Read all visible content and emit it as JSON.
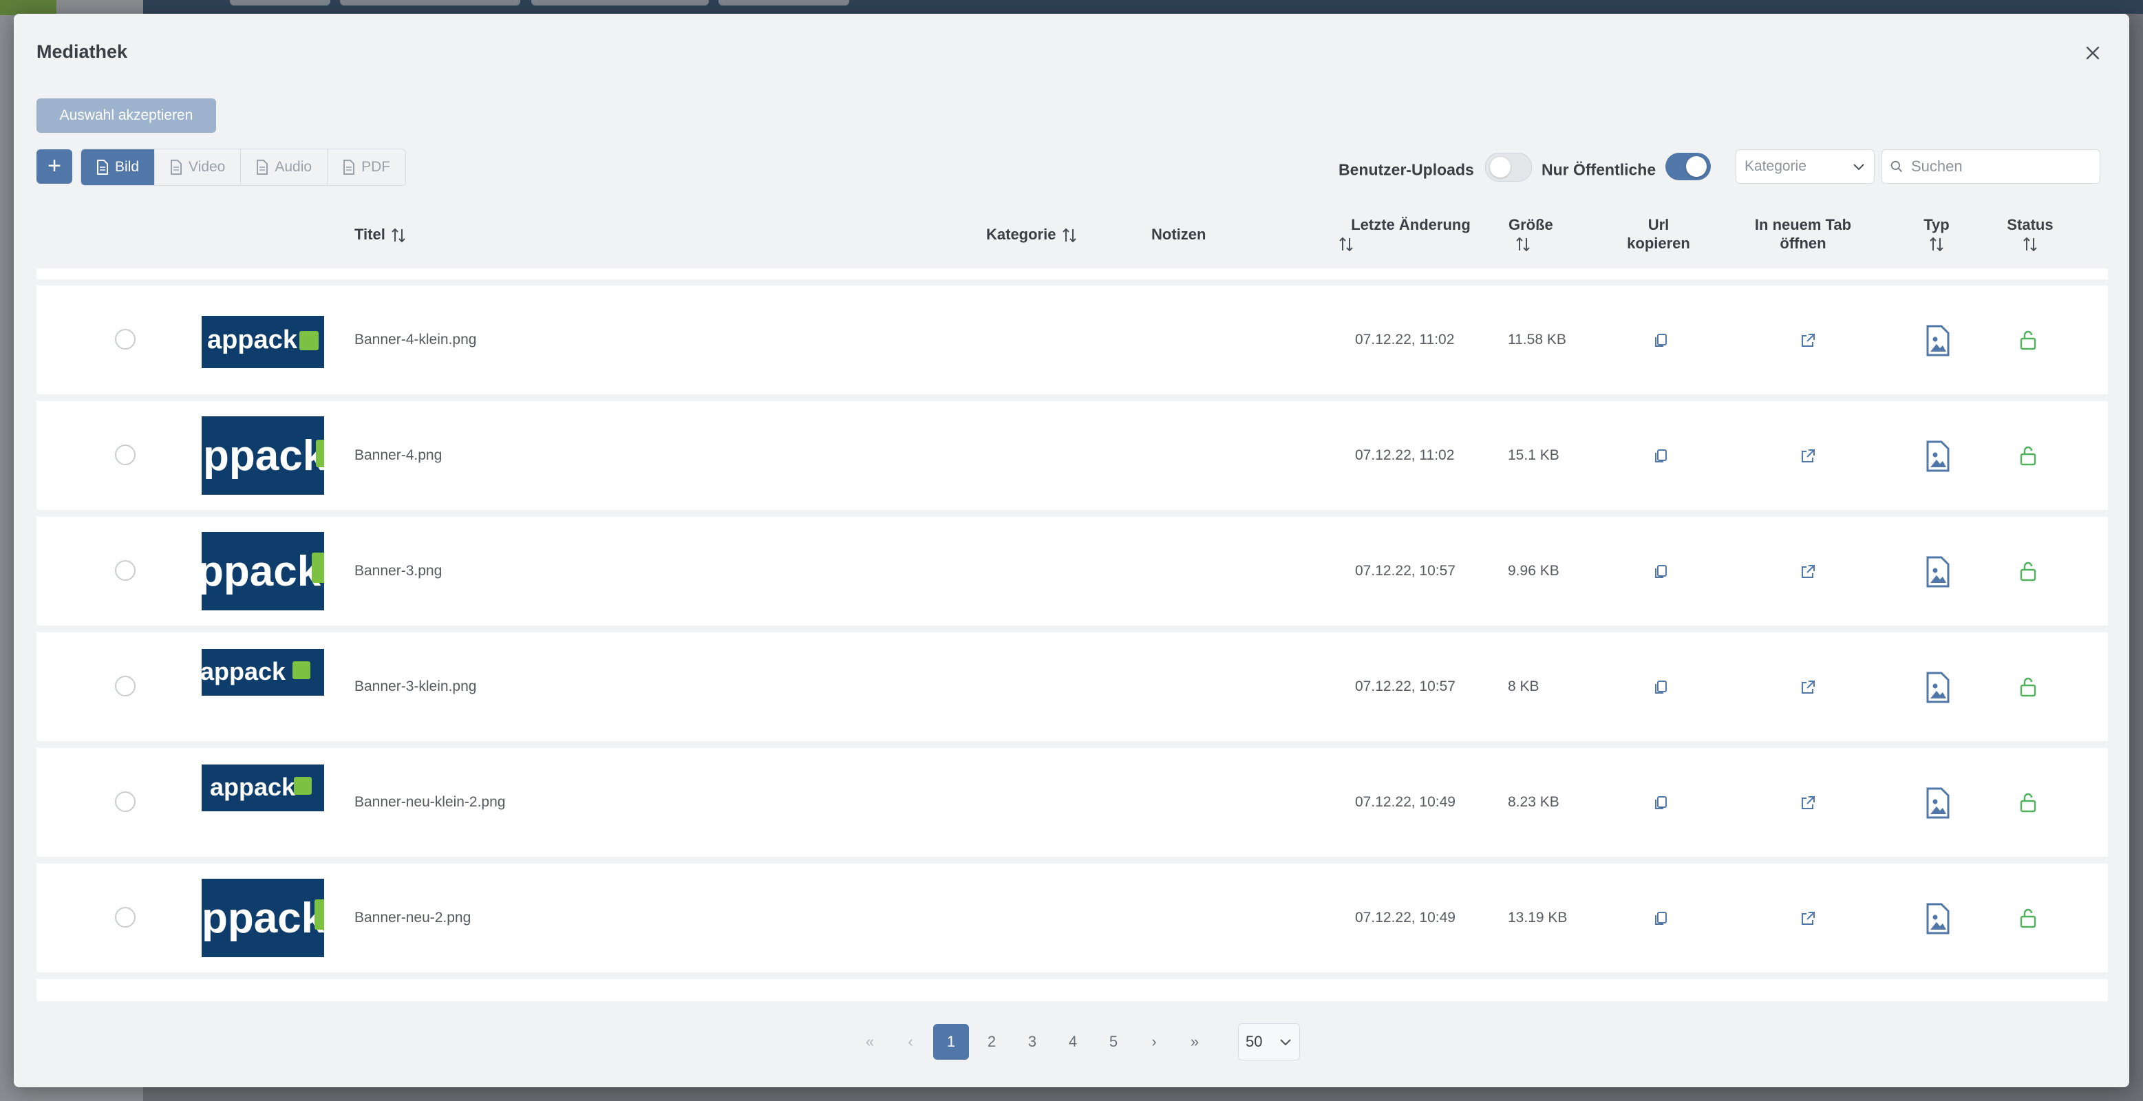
{
  "modal": {
    "title": "Mediathek",
    "accept_button": "Auswahl akzeptieren"
  },
  "toolbar": {
    "add_label": "+",
    "media_types": [
      "Bild",
      "Video",
      "Audio",
      "PDF"
    ],
    "active_media_type": "Bild",
    "toggle_user_uploads": {
      "label": "Benutzer-Uploads",
      "on": false
    },
    "toggle_public_only": {
      "label": "Nur Öffentliche",
      "on": true
    },
    "category_select": "Kategorie",
    "search_placeholder": "Suchen"
  },
  "table": {
    "headers": {
      "title": "Titel",
      "category": "Kategorie",
      "notes": "Notizen",
      "last_change_1": "Letzte Änderung",
      "size": "Größe",
      "url_copy_1": "Url",
      "url_copy_2": "kopieren",
      "new_tab_1": "In neuem Tab",
      "new_tab_2": "öffnen",
      "type": "Typ",
      "status": "Status"
    },
    "rows": [
      {
        "title": "Banner-4-klein.png",
        "date": "07.12.22, 11:02",
        "size": "11.58 KB",
        "thumb_text": "appack"
      },
      {
        "title": "Banner-4.png",
        "date": "07.12.22, 11:02",
        "size": "15.1 KB",
        "thumb_text": "ppack"
      },
      {
        "title": "Banner-3.png",
        "date": "07.12.22, 10:57",
        "size": "9.96 KB",
        "thumb_text": "ppack"
      },
      {
        "title": "Banner-3-klein.png",
        "date": "07.12.22, 10:57",
        "size": "8 KB",
        "thumb_text": "appack"
      },
      {
        "title": "Banner-neu-klein-2.png",
        "date": "07.12.22, 10:49",
        "size": "8.23 KB",
        "thumb_text": "appack"
      },
      {
        "title": "Banner-neu-2.png",
        "date": "07.12.22, 10:49",
        "size": "13.19 KB",
        "thumb_text": "ppack"
      }
    ]
  },
  "pagination": {
    "first": "«",
    "prev": "‹",
    "pages": [
      "1",
      "2",
      "3",
      "4",
      "5"
    ],
    "current": "1",
    "next": "›",
    "last": "»",
    "per_page": "50"
  },
  "colors": {
    "accent": "#5077a8",
    "status_green": "#52b05a",
    "brand_navy": "#0e3d6b",
    "brand_green": "#7cc142"
  }
}
